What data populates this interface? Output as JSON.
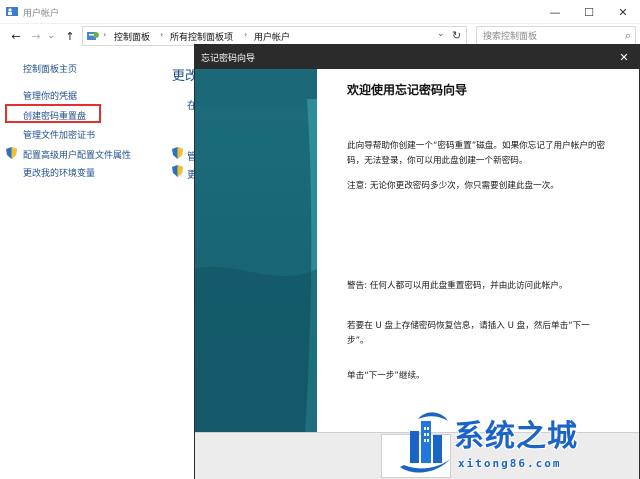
{
  "window": {
    "title": "用户帐户",
    "minimize_glyph": "—",
    "maximize_glyph": "☐",
    "close_glyph": "✕"
  },
  "nav": {
    "back_glyph": "←",
    "forward_glyph": "→",
    "dropdown_glyph": "⌄",
    "up_glyph": "↑",
    "breadcrumb": [
      "控制面板",
      "所有控制面板项",
      "用户帐户"
    ],
    "separator": "›",
    "address_dropdown_glyph": "⌄",
    "refresh_glyph": "↻",
    "search_placeholder": "搜索控制面板",
    "search_icon_glyph": "⌕"
  },
  "sidebar": {
    "items": [
      {
        "label": "控制面板主页"
      },
      {
        "label": "管理你的凭据"
      },
      {
        "label": "创建密码重置盘"
      },
      {
        "label": "管理文件加密证书"
      },
      {
        "label": "配置高级用户配置文件属性"
      },
      {
        "label": "更改我的环境变量"
      }
    ]
  },
  "main": {
    "heading": "更改",
    "fragments": [
      "在",
      "管",
      "更"
    ]
  },
  "wizard": {
    "title": "忘记密码向导",
    "close_glyph": "✕",
    "heading": "欢迎使用忘记密码向导",
    "paragraphs": [
      "此向导帮助你创建一个“密码重置”磁盘。如果你忘记了用户帐户的密码，无法登录，你可以用此盘创建一个新密码。",
      "注意: 无论你更改密码多少次，你只需要创建此盘一次。",
      "警告: 任何人都可以用此盘重置密码，并由此访问此帐户。",
      "若要在 U 盘上存储密码恢复信息，请插入 U 盘，然后单击“下一步”。",
      "单击“下一步”继续。"
    ]
  },
  "watermark": {
    "text": "系统之城",
    "url": "xitong86.com"
  },
  "colors": {
    "link": "#1e4f8a",
    "wizard_title_bar": "#2b2b2b",
    "wizard_side": "#176070",
    "highlight_box": "#e03030",
    "watermark": "#1a64c8"
  }
}
